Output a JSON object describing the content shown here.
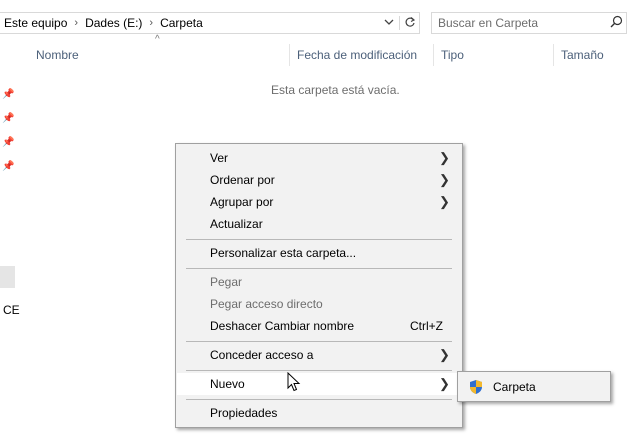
{
  "address": {
    "crumbs": [
      "Este equipo",
      "Dades (E:)",
      "Carpeta"
    ],
    "separator": "›",
    "dropdown_icon": "chevron-down-icon",
    "refresh_icon": "refresh-icon"
  },
  "search": {
    "placeholder": "Buscar en Carpeta",
    "icon": "search-icon"
  },
  "columns": [
    "Nombre",
    "Fecha de modificación",
    "Tipo",
    "Tamaño"
  ],
  "empty_message": "Esta carpeta está vacía.",
  "nav": {
    "partial_label": "CE"
  },
  "context_menu": {
    "items": [
      {
        "label": "Ver",
        "submenu": true
      },
      {
        "label": "Ordenar por",
        "submenu": true
      },
      {
        "label": "Agrupar por",
        "submenu": true
      },
      {
        "label": "Actualizar"
      },
      {
        "label": "Personalizar esta carpeta..."
      },
      {
        "label": "Pegar",
        "disabled": true
      },
      {
        "label": "Pegar acceso directo",
        "disabled": true
      },
      {
        "label": "Deshacer Cambiar nombre",
        "shortcut": "Ctrl+Z"
      },
      {
        "label": "Conceder acceso a",
        "submenu": true
      },
      {
        "label": "Nuevo",
        "submenu": true,
        "highlighted": true
      },
      {
        "label": "Propiedades"
      }
    ]
  },
  "submenu": {
    "items": [
      {
        "label": "Carpeta",
        "icon": "shield-icon"
      }
    ]
  },
  "colors": {
    "header_text": "#4c607a",
    "menu_bg": "#f2f2f2",
    "highlight": "#ffffff"
  }
}
